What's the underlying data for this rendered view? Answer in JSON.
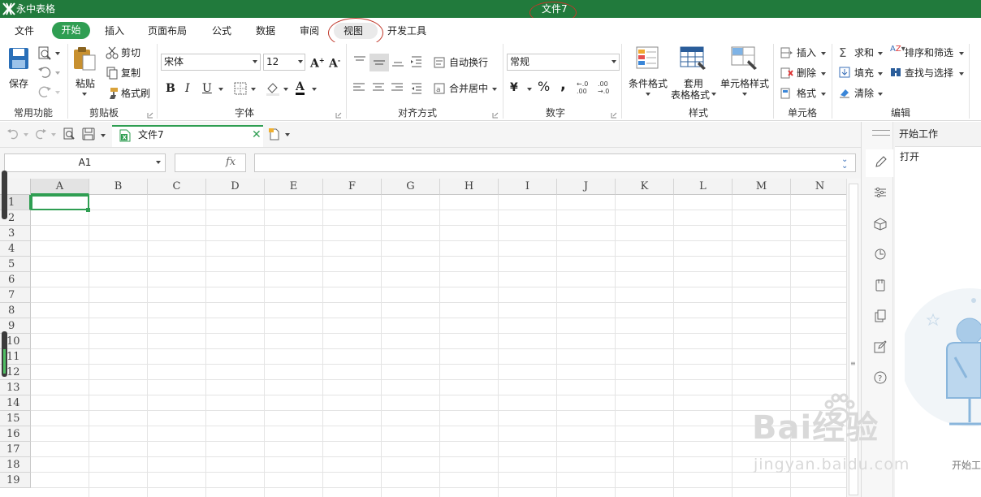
{
  "app": {
    "name": "永中表格",
    "document_title": "文件7"
  },
  "menu": {
    "file": "文件",
    "home": "开始",
    "insert": "插入",
    "page_layout": "页面布局",
    "formula": "公式",
    "data": "数据",
    "review": "审阅",
    "view": "视图",
    "developer": "开发工具"
  },
  "ribbon": {
    "common": {
      "save": "保存",
      "group": "常用功能"
    },
    "clipboard": {
      "paste": "粘贴",
      "cut": "剪切",
      "copy": "复制",
      "format_painter": "格式刷",
      "group": "剪贴板"
    },
    "font": {
      "name": "宋体",
      "size": "12",
      "bold": "B",
      "italic": "I",
      "underline": "U",
      "font_color": "A",
      "group": "字体"
    },
    "alignment": {
      "wrap": "自动换行",
      "merge": "合并居中",
      "group": "对齐方式"
    },
    "number": {
      "format": "常规",
      "currency": "¥",
      "percent": "%",
      "comma": ",",
      "group": "数字"
    },
    "styles": {
      "conditional": "条件格式",
      "table_format_1": "套用",
      "table_format_2": "表格格式",
      "cell_style": "单元格样式",
      "group": "样式"
    },
    "cells": {
      "insert": "插入",
      "delete": "删除",
      "format": "格式",
      "group": "单元格"
    },
    "editing": {
      "sum": "求和",
      "sort_filter": "排序和筛选",
      "fill": "填充",
      "find_select": "查找与选择",
      "clear": "清除",
      "group": "编辑"
    }
  },
  "tab": {
    "name": "文件7"
  },
  "formula_bar": {
    "name_box": "A1",
    "fx": "fx",
    "formula": ""
  },
  "sheet": {
    "columns": [
      "A",
      "B",
      "C",
      "D",
      "E",
      "F",
      "G",
      "H",
      "I",
      "J",
      "K",
      "L",
      "M",
      "N"
    ],
    "rows": [
      "1",
      "2",
      "3",
      "4",
      "5",
      "6",
      "7",
      "8",
      "9",
      "10",
      "11",
      "12",
      "13",
      "14",
      "15",
      "16",
      "17",
      "18",
      "19"
    ],
    "selected_cell": "A1"
  },
  "taskpane": {
    "title": "开始工作",
    "open": "打开",
    "start_label": "开始工"
  },
  "watermark": {
    "brand": "Bai经验",
    "url": "jingyan.baidu.com"
  },
  "colors": {
    "accent": "#217a3c",
    "home_tab": "#2f9e52",
    "highlight_ellipse": "#c0392b"
  }
}
